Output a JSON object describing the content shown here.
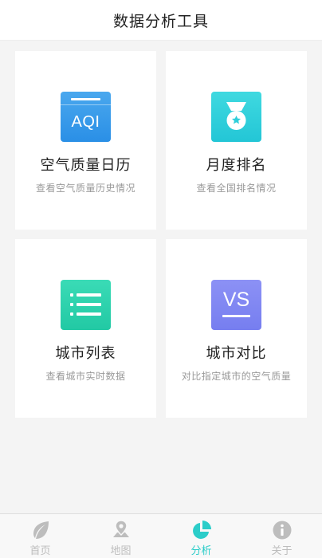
{
  "header": {
    "title": "数据分析工具"
  },
  "cards": [
    {
      "title": "空气质量日历",
      "subtitle": "查看空气质量历史情况",
      "icon": "aqi-calendar-icon",
      "icon_text": "AQI",
      "color_top": "#4aa8ee",
      "color_bottom": "#2a8fe6"
    },
    {
      "title": "月度排名",
      "subtitle": "查看全国排名情况",
      "icon": "medal-icon",
      "color_top": "#3fd9e0",
      "color_bottom": "#23c6d6"
    },
    {
      "title": "城市列表",
      "subtitle": "查看城市实时数据",
      "icon": "list-icon",
      "color_top": "#3adbb6",
      "color_bottom": "#22c9a4"
    },
    {
      "title": "城市对比",
      "subtitle": "对比指定城市的空气质量",
      "icon": "vs-compare-icon",
      "icon_text": "VS",
      "color_top": "#8c91f5",
      "color_bottom": "#767ef0"
    }
  ],
  "tabbar": {
    "items": [
      {
        "label": "首页",
        "icon": "leaf-icon",
        "active": false
      },
      {
        "label": "地图",
        "icon": "map-pin-icon",
        "active": false
      },
      {
        "label": "分析",
        "icon": "pie-chart-icon",
        "active": true
      },
      {
        "label": "关于",
        "icon": "info-icon",
        "active": false
      }
    ],
    "active_color": "#2ccdc9",
    "inactive_color": "#bdbdbd"
  }
}
